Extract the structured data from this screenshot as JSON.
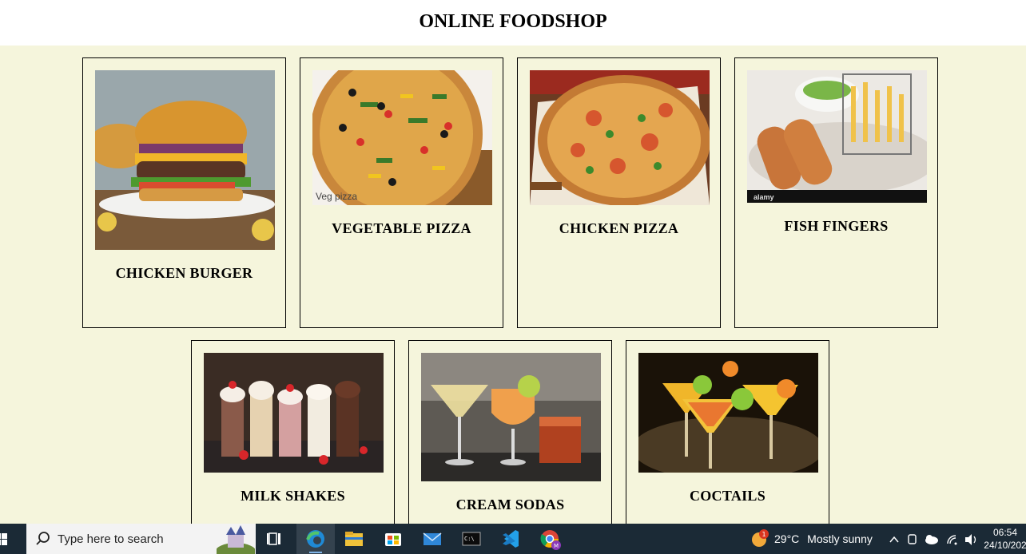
{
  "page": {
    "title": "ONLINE FOODSHOP"
  },
  "products": [
    {
      "name": "CHICKEN BURGER",
      "image_caption": ""
    },
    {
      "name": "VEGETABLE PIZZA",
      "image_caption": "Veg pizza"
    },
    {
      "name": "CHICKEN PIZZA",
      "image_caption": ""
    },
    {
      "name": "FISH FINGERS",
      "image_caption": "alamy"
    },
    {
      "name": "MILK SHAKES",
      "image_caption": ""
    },
    {
      "name": "CREAM SODAS",
      "image_caption": ""
    },
    {
      "name": "COCTAILS",
      "image_caption": ""
    }
  ],
  "taskbar": {
    "search_placeholder": "Type here to search",
    "weather": {
      "temp": "29°C",
      "condition": "Mostly sunny",
      "badge": "1"
    },
    "clock": {
      "time": "06:54",
      "date": "24/10/202"
    }
  },
  "colors": {
    "page_bg": "#f5f5dc",
    "header_bg": "#ffffff",
    "taskbar_bg": "#1b2a36"
  }
}
